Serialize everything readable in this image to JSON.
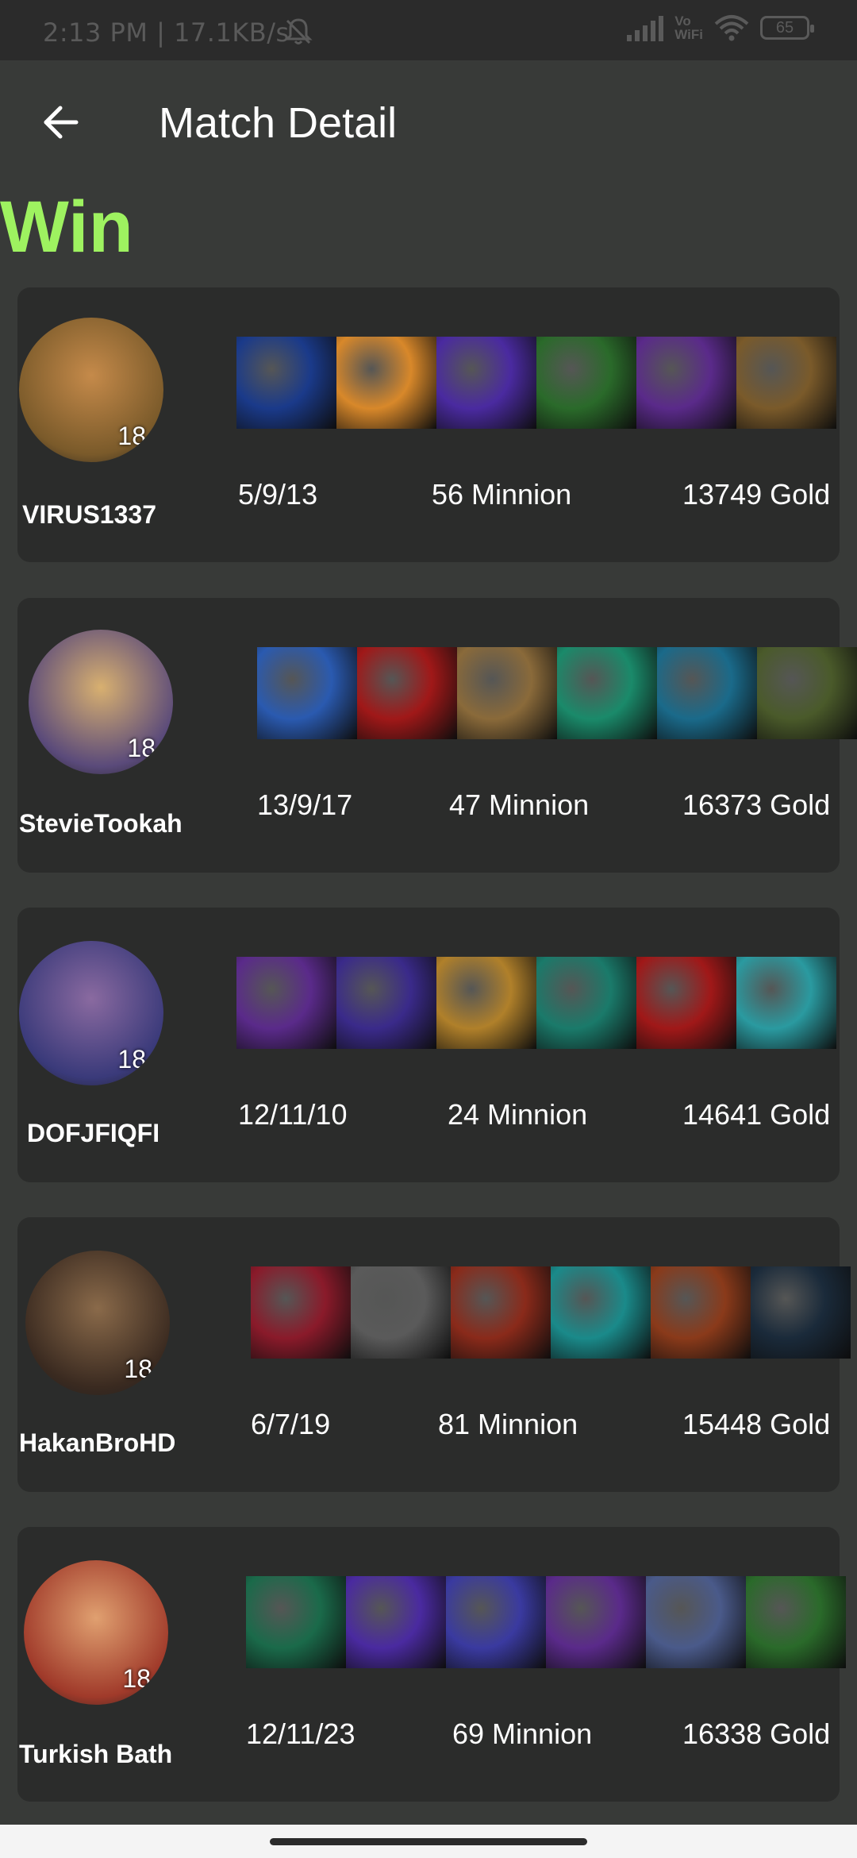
{
  "status_bar": {
    "time_net": "2:13 PM | 17.1KB/s",
    "vowifi_top": "Vo",
    "vowifi_bottom": "WiFi",
    "battery": "65"
  },
  "app_bar": {
    "title": "Match Detail"
  },
  "result": {
    "label": "Win",
    "color": "#9ef260"
  },
  "players": [
    {
      "name": "VIRUS1337",
      "level": "18",
      "kda": "5/9/13",
      "minions": "56 Minnion",
      "gold": "13749 Gold",
      "avatar_colors": [
        "#7a5a2a",
        "#c58a4a"
      ],
      "items": [
        "#1a3a8a",
        "#d8882a",
        "#4a2aa0",
        "#2a6a2a",
        "#5a2a8a",
        "#7a5a2a"
      ]
    },
    {
      "name": "StevieTookah",
      "level": "18",
      "kda": "13/9/17",
      "minions": "47 Minnion",
      "gold": "16373 Gold",
      "avatar_colors": [
        "#5a4a7a",
        "#d8b070"
      ],
      "items": [
        "#2a5ab0",
        "#a01818",
        "#8a6a3a",
        "#1a8a6a",
        "#1a6a8a",
        "#4a5a2a"
      ]
    },
    {
      "name": "DOFJFIQFI",
      "level": "18",
      "kda": "12/11/10",
      "minions": "24 Minnion",
      "gold": "14641 Gold",
      "avatar_colors": [
        "#3a3a7a",
        "#8a6aa0"
      ],
      "items": [
        "#5a2a8a",
        "#3a2a8a",
        "#b0802a",
        "#1a7a6a",
        "#a01818",
        "#2a9aa0"
      ]
    },
    {
      "name": "HakanBroHD",
      "level": "18",
      "kda": "6/7/19",
      "minions": "81 Minnion",
      "gold": "15448 Gold",
      "avatar_colors": [
        "#3a2a20",
        "#8a6a4a"
      ],
      "items": [
        "#8a1a2a",
        "#5a5a5a",
        "#8a2a1a",
        "#1a8a8a",
        "#8a3a1a",
        "#1a2a3a"
      ]
    },
    {
      "name": "Turkish Bath",
      "level": "18",
      "kda": "12/11/23",
      "minions": "69 Minnion",
      "gold": "16338 Gold",
      "avatar_colors": [
        "#a03a2a",
        "#e0a070"
      ],
      "items": [
        "#1a6a4a",
        "#4a2aa0",
        "#3a3aa0",
        "#5a2a8a",
        "#4a5a8a",
        "#2a6a2a"
      ]
    }
  ]
}
